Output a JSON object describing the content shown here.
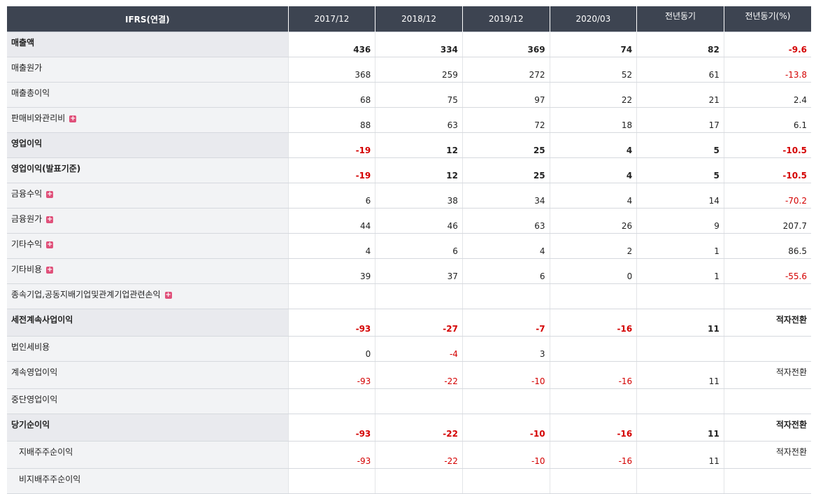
{
  "table": {
    "header": [
      "IFRS(연결)",
      "2017/12",
      "2018/12",
      "2019/12",
      "2020/03",
      "전년동기",
      "전년동기(%)"
    ],
    "rows": [
      {
        "label": "매출액",
        "bold": true,
        "major": true,
        "values": [
          "436",
          "334",
          "369",
          "74",
          "82",
          "-9.6"
        ]
      },
      {
        "label": "매출원가",
        "values": [
          "368",
          "259",
          "272",
          "52",
          "61",
          "-13.8"
        ]
      },
      {
        "label": "매출총이익",
        "values": [
          "68",
          "75",
          "97",
          "22",
          "21",
          "2.4"
        ]
      },
      {
        "label": "판매비와관리비",
        "expand": true,
        "values": [
          "88",
          "63",
          "72",
          "18",
          "17",
          "6.1"
        ]
      },
      {
        "label": "영업이익",
        "bold": true,
        "major": true,
        "values": [
          "-19",
          "12",
          "25",
          "4",
          "5",
          "-10.5"
        ]
      },
      {
        "label": "영업이익(발표기준)",
        "bold": true,
        "values": [
          "-19",
          "12",
          "25",
          "4",
          "5",
          "-10.5"
        ]
      },
      {
        "label": "금융수익",
        "expand": true,
        "values": [
          "6",
          "38",
          "34",
          "4",
          "14",
          "-70.2"
        ]
      },
      {
        "label": "금융원가",
        "expand": true,
        "values": [
          "44",
          "46",
          "63",
          "26",
          "9",
          "207.7"
        ]
      },
      {
        "label": "기타수익",
        "expand": true,
        "values": [
          "4",
          "6",
          "4",
          "2",
          "1",
          "86.5"
        ]
      },
      {
        "label": "기타비용",
        "expand": true,
        "values": [
          "39",
          "37",
          "6",
          "0",
          "1",
          "-55.6"
        ]
      },
      {
        "label": "종속기업,공동지배기업및관계기업관련손익",
        "expand": true,
        "values": [
          "",
          "",
          "",
          "",
          "",
          ""
        ]
      },
      {
        "label": "세전계속사업이익",
        "bold": true,
        "major": true,
        "values": [
          "-93",
          "-27",
          "-7",
          "-16",
          "11",
          "적자전환"
        ]
      },
      {
        "label": "법인세비용",
        "values": [
          "0",
          "-4",
          "3",
          "",
          "",
          ""
        ]
      },
      {
        "label": "계속영업이익",
        "values": [
          "-93",
          "-22",
          "-10",
          "-16",
          "11",
          "적자전환"
        ]
      },
      {
        "label": "중단영업이익",
        "values": [
          "",
          "",
          "",
          "",
          "",
          ""
        ]
      },
      {
        "label": "당기순이익",
        "bold": true,
        "major": true,
        "values": [
          "-93",
          "-22",
          "-10",
          "-16",
          "11",
          "적자전환"
        ]
      },
      {
        "label": "지배주주순이익",
        "sub": true,
        "values": [
          "-93",
          "-22",
          "-10",
          "-16",
          "11",
          "적자전환"
        ]
      },
      {
        "label": "비지배주주순이익",
        "sub": true,
        "values": [
          "",
          "",
          "",
          "",
          "",
          ""
        ]
      }
    ]
  },
  "icons": {
    "expand": "plus-box-icon"
  },
  "colors": {
    "header_bg": "#3d4451",
    "negative": "#d40000",
    "label_bg": "#f2f3f5"
  }
}
